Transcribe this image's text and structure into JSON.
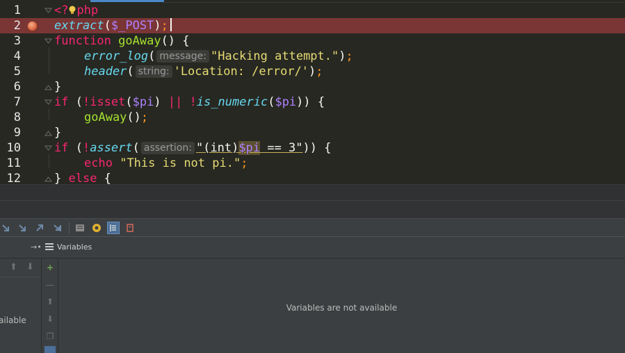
{
  "editor": {
    "line_numbers": [
      "1",
      "2",
      "3",
      "4",
      "5",
      "6",
      "7",
      "8",
      "9",
      "10",
      "11",
      "12"
    ],
    "lines": {
      "l1": {
        "open": "<?",
        "kw": "php"
      },
      "l2": {
        "fn": "extract",
        "p1": "(",
        "var": "$_POST",
        "p2": ")",
        "semi": ";"
      },
      "l3": {
        "kw": "function",
        "name": "goAway",
        "rest": "() {"
      },
      "l4": {
        "fn": "error_log",
        "p1": "(",
        "hint": "message:",
        "str": "\"Hacking attempt.\"",
        "p2": ")",
        "semi": ";"
      },
      "l5": {
        "fn": "header",
        "p1": "(",
        "hint": "string:",
        "str": "'Location: /error/'",
        "p2": ")",
        "semi": ";"
      },
      "l6": {
        "brace": "}"
      },
      "l7": {
        "kw": "if",
        "p1": " (",
        "not1": "!",
        "kw2": "isset",
        "p2": "(",
        "var1": "$pi",
        "p3": ") ",
        "or": "||",
        "sp": " ",
        "not2": "!",
        "fn": "is_numeric",
        "p4": "(",
        "var2": "$pi",
        "p5": ")) {"
      },
      "l8": {
        "fn": "goAway",
        "p": "()",
        "semi": ";"
      },
      "l9": {
        "brace": "}"
      },
      "l10": {
        "kw": "if",
        "p1": " (",
        "not": "!",
        "fn": "assert",
        "p2": "(",
        "hint": "assertion:",
        "str1": "\"(int)",
        "var": "$pi",
        "str2": " == 3\"",
        "p3": ")) {"
      },
      "l11": {
        "kw": "echo",
        "sp": " ",
        "str": "\"This is not pi.\"",
        "semi": ";"
      },
      "l12": {
        "brace": "} ",
        "kw": "else",
        "rest": " {"
      }
    },
    "breakpoint_line": "2"
  },
  "debug_toolbar": {
    "icons": [
      "step-over-icon",
      "step-into-icon",
      "step-out-icon",
      "run-to-cursor-icon",
      "evaluate-icon",
      "watch-icon",
      "variables-view-icon",
      "clear-icon"
    ]
  },
  "variables_panel": {
    "title": "Variables",
    "frames_text": "ailable",
    "empty_message": "Variables are not available"
  },
  "colors": {
    "editor_bg": "#272822",
    "breakpoint_line": "#7a3535",
    "keyword": "#f92672",
    "function": "#a6e22e",
    "builtin_italic": "#66d9ef",
    "variable": "#ae81ff",
    "string": "#e6db74",
    "panel_bg": "#3c3f41"
  }
}
